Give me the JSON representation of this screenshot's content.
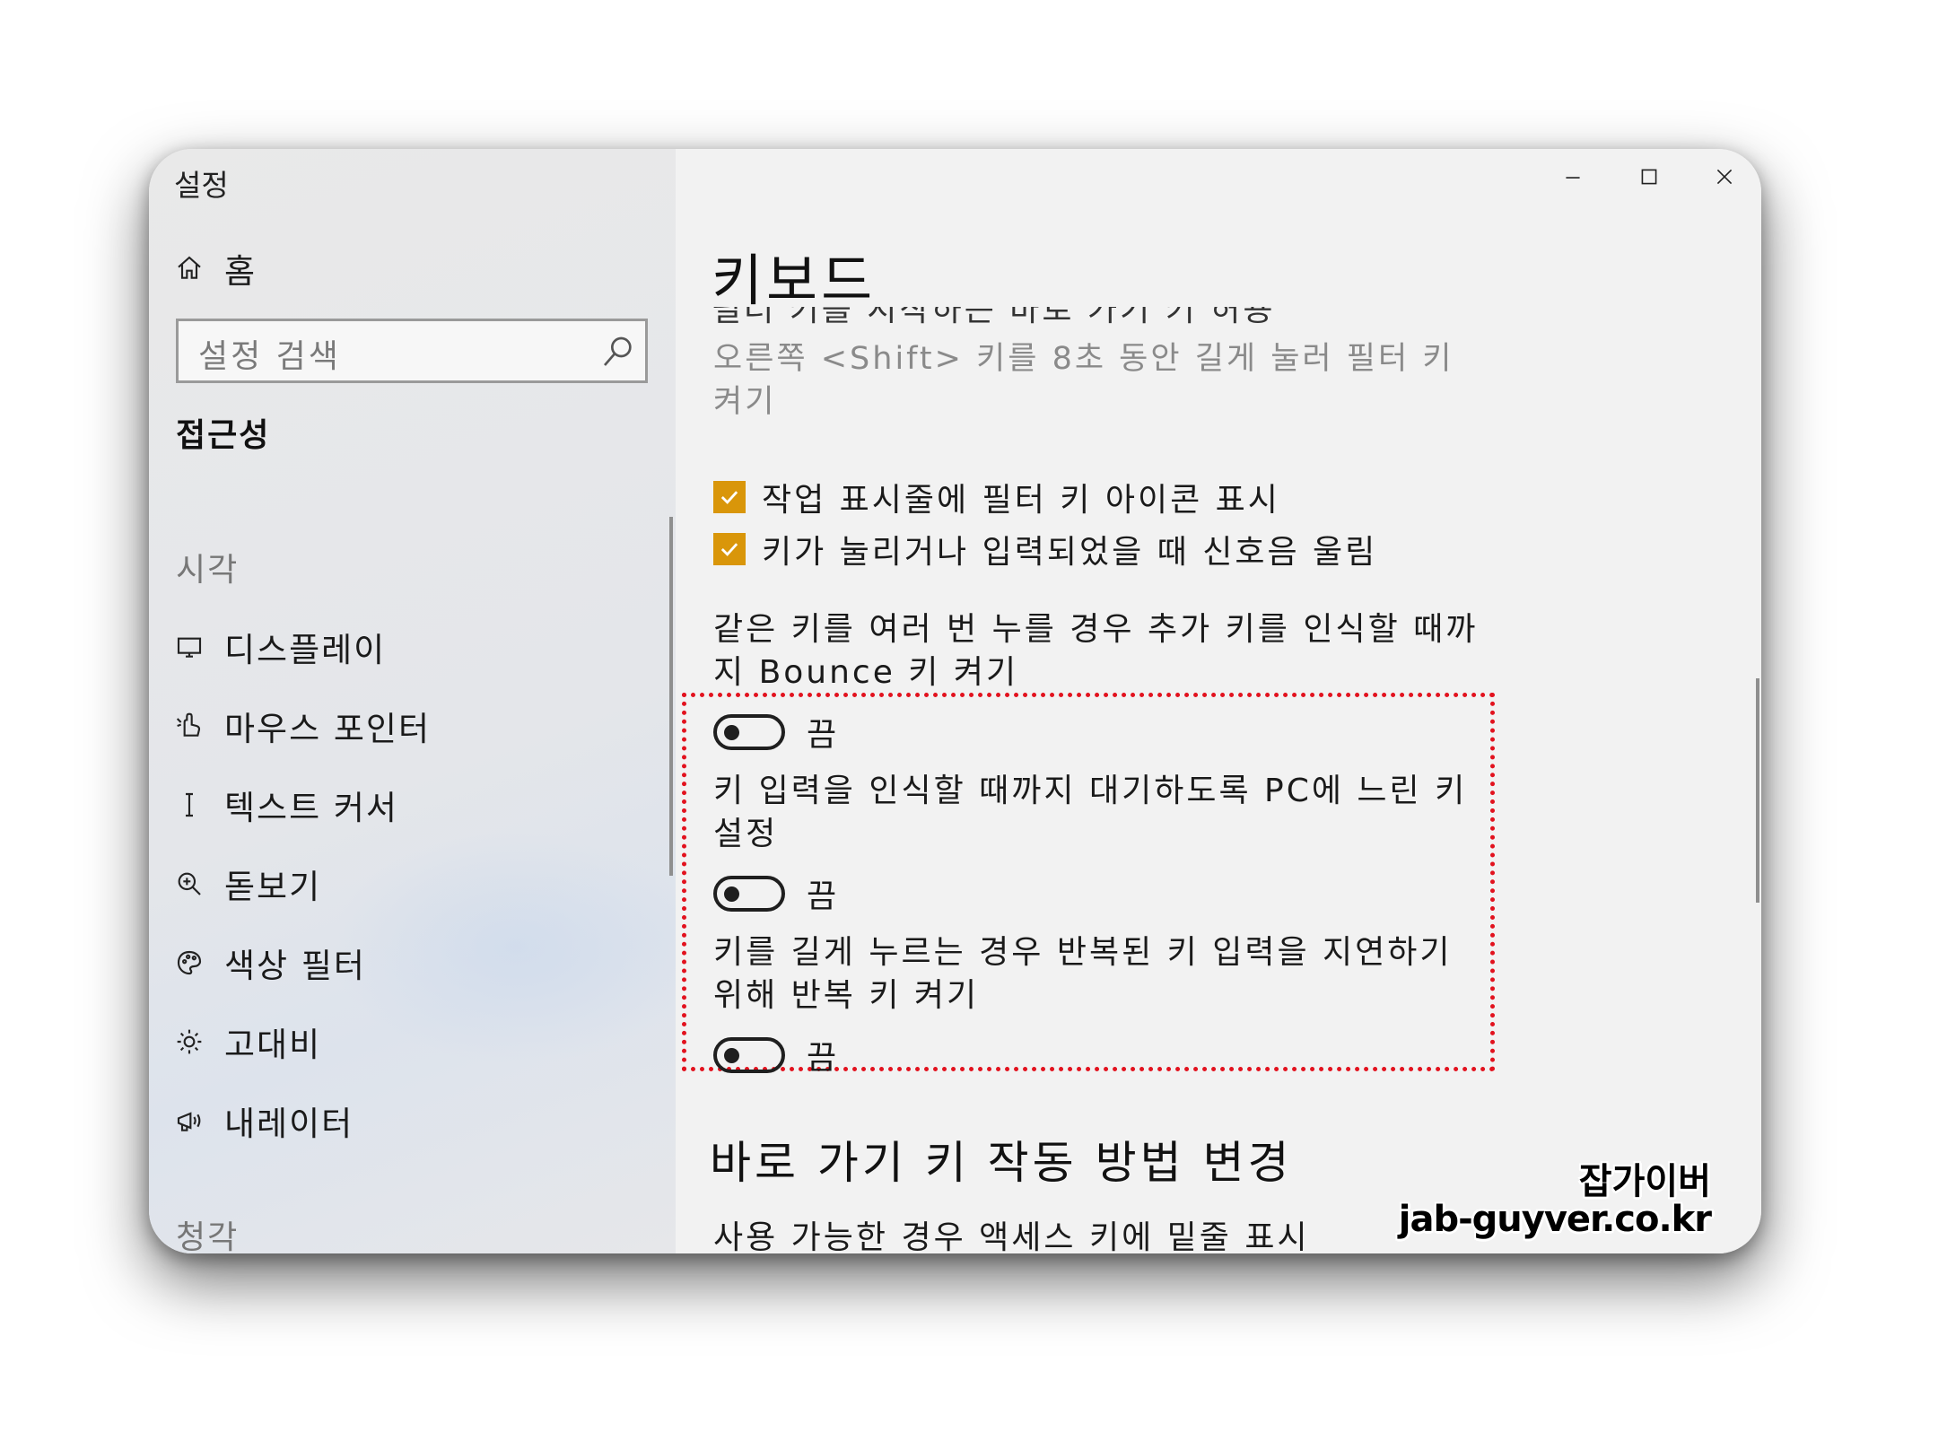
{
  "window": {
    "title": "설정",
    "controls": {
      "minimize": "minimize-icon",
      "maximize": "maximize-icon",
      "close": "close-icon"
    }
  },
  "sidebar": {
    "home_label": "홈",
    "search_placeholder": "설정 검색",
    "section_title": "접근성",
    "group_vision": "시각",
    "items": [
      {
        "label": "디스플레이",
        "icon": "display-icon"
      },
      {
        "label": "마우스 포인터",
        "icon": "mouse-pointer-icon"
      },
      {
        "label": "텍스트 커서",
        "icon": "text-cursor-icon"
      },
      {
        "label": "돋보기",
        "icon": "magnifier-icon"
      },
      {
        "label": "색상 필터",
        "icon": "color-filter-icon"
      },
      {
        "label": "고대비",
        "icon": "high-contrast-icon"
      },
      {
        "label": "내레이터",
        "icon": "narrator-icon"
      }
    ],
    "group_hearing": "청각"
  },
  "main": {
    "page_title": "키보드",
    "cut_text": "필터 키를 시작하는 바로 가기 키 허용",
    "filter_shortcut_link": "오른쪽 <Shift> 키를 8초 동안 길게 눌러 필터 키 켜기",
    "checkboxes": [
      {
        "label": "작업 표시줄에 필터 키 아이콘 표시",
        "checked": true
      },
      {
        "label": "키가 눌리거나 입력되었을 때 신호음 울림",
        "checked": true
      }
    ],
    "settings": [
      {
        "description": "같은 키를 여러 번 누를 경우 추가 키를 인식할 때까지 Bounce 키 켜기",
        "state": "끔"
      },
      {
        "description": "키 입력을 인식할 때까지 대기하도록 PC에 느린 키 설정",
        "state": "끔"
      },
      {
        "description": "키를 길게 누르는 경우 반복된 키 입력을 지연하기 위해 반복 키 켜기",
        "state": "끔"
      }
    ],
    "shortcut_heading": "바로 가기 키 작동 방법 변경",
    "underline_text": "사용 가능한 경우 액세스 키에 밑줄 표시"
  },
  "watermark": {
    "name": "잡가이버",
    "url": "jab-guyver.co.kr"
  },
  "colors": {
    "accent": "#d9960a",
    "highlight": "#e2121e"
  }
}
